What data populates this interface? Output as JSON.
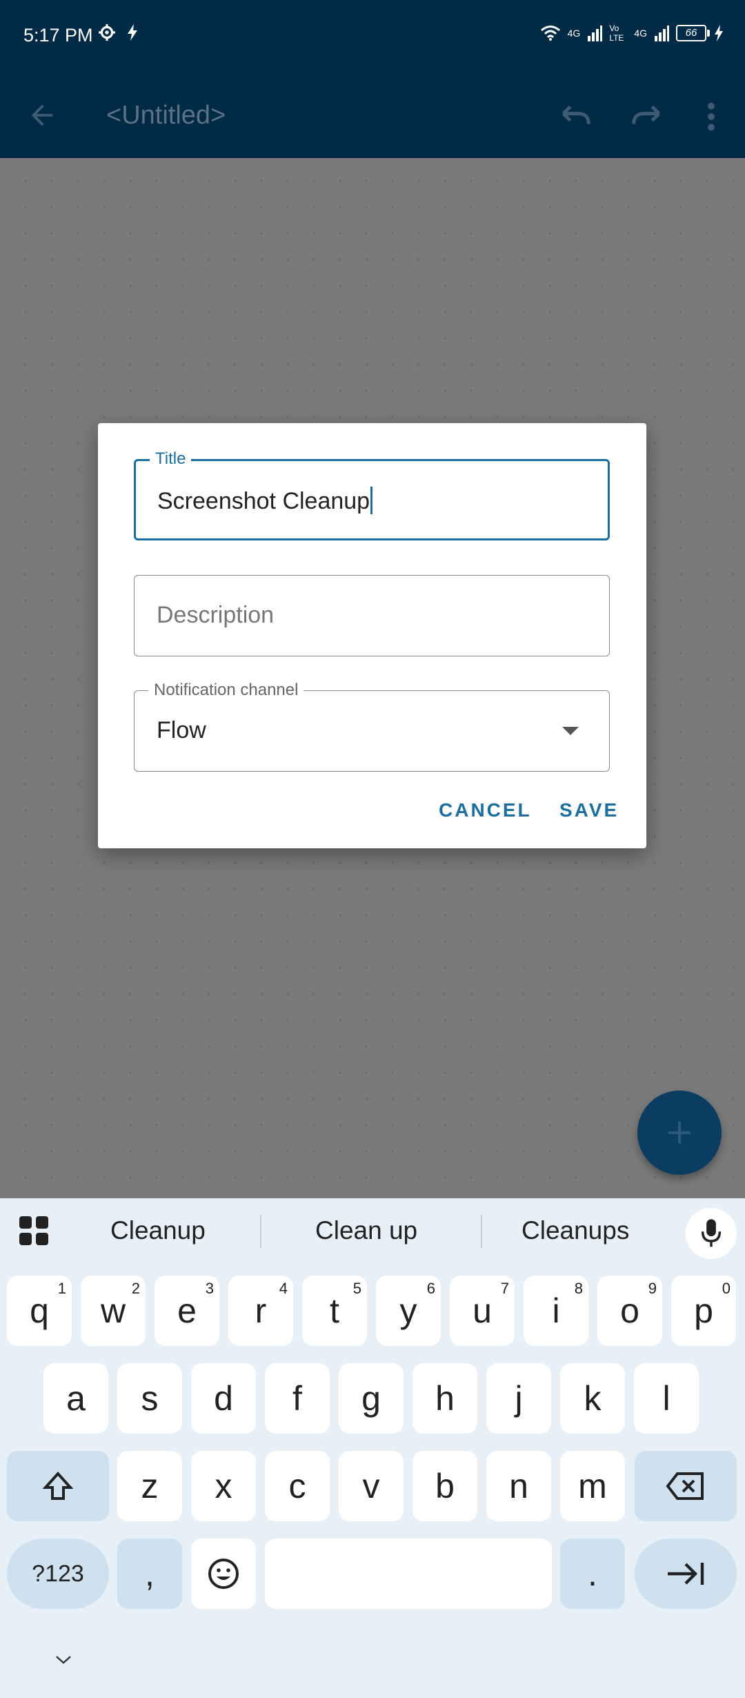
{
  "status": {
    "time": "5:17 PM",
    "net1": "4G",
    "net2": "Vo LTE",
    "net3": "4G",
    "battery": "66"
  },
  "appbar": {
    "title": "<Untitled>",
    "back_icon": "arrow-left-icon",
    "undo_icon": "undo-icon",
    "redo_icon": "redo-icon",
    "more_icon": "more-vert-icon"
  },
  "dialog": {
    "title_field": {
      "label": "Title",
      "value": "Screenshot Cleanup"
    },
    "description_field": {
      "placeholder": "Description"
    },
    "channel_field": {
      "label": "Notification channel",
      "value": "Flow"
    },
    "cancel_label": "CANCEL",
    "save_label": "SAVE"
  },
  "fab": {
    "icon": "plus-icon"
  },
  "keyboard": {
    "suggestions": [
      "Cleanup",
      "Clean up",
      "Cleanups"
    ],
    "row1": [
      {
        "k": "q",
        "h": "1"
      },
      {
        "k": "w",
        "h": "2"
      },
      {
        "k": "e",
        "h": "3"
      },
      {
        "k": "r",
        "h": "4"
      },
      {
        "k": "t",
        "h": "5"
      },
      {
        "k": "y",
        "h": "6"
      },
      {
        "k": "u",
        "h": "7"
      },
      {
        "k": "i",
        "h": "8"
      },
      {
        "k": "o",
        "h": "9"
      },
      {
        "k": "p",
        "h": "0"
      }
    ],
    "row2": [
      "a",
      "s",
      "d",
      "f",
      "g",
      "h",
      "j",
      "k",
      "l"
    ],
    "row3": [
      "z",
      "x",
      "c",
      "v",
      "b",
      "n",
      "m"
    ],
    "symbols_label": "?123",
    "comma": ",",
    "period": "."
  },
  "colors": {
    "appbar": "#002a45",
    "accent": "#1a6fa0",
    "fab": "#0b3d63",
    "keyboard_bg": "#e8f0f7",
    "mod_key": "#cfe0ee"
  }
}
